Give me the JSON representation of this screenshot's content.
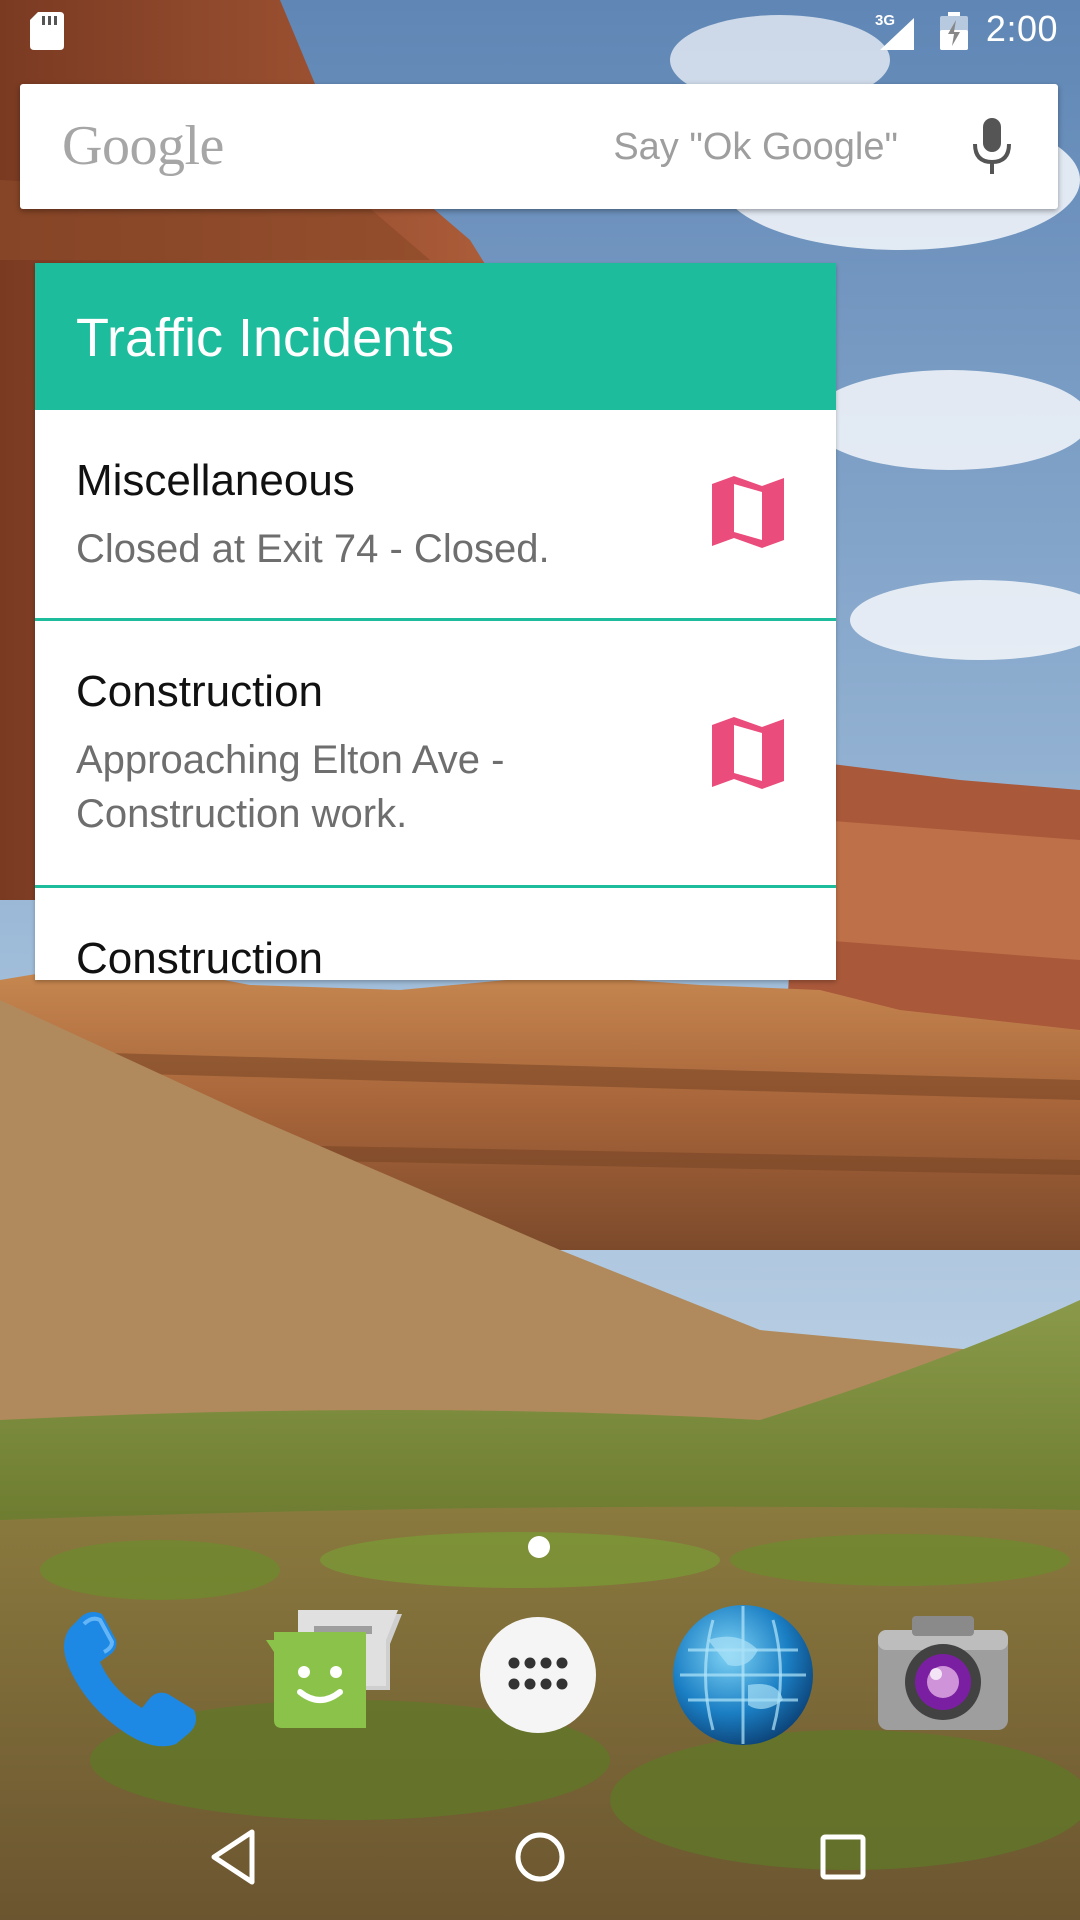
{
  "status_bar": {
    "network": "3G",
    "time": "2:00",
    "icons": [
      "sd-card-icon",
      "signal-icon",
      "battery-charging-icon"
    ]
  },
  "search_bar": {
    "logo": "Google",
    "hint": "Say \"Ok Google\"",
    "icon": "mic-icon"
  },
  "widget": {
    "title": "Traffic Incidents",
    "accent_color": "#1dbc9c",
    "map_icon_color": "#ea4c7c",
    "incidents": [
      {
        "type": "Miscellaneous",
        "description": "Closed at Exit 74 - Closed.",
        "icon": "map-icon"
      },
      {
        "type": "Construction",
        "description": "Approaching Elton Ave - Construction work.",
        "icon": "map-icon"
      },
      {
        "type": "Construction",
        "description": "",
        "icon": ""
      }
    ]
  },
  "dock": {
    "apps": [
      {
        "name": "phone-icon"
      },
      {
        "name": "messaging-icon"
      },
      {
        "name": "app-drawer-icon"
      },
      {
        "name": "browser-icon"
      },
      {
        "name": "camera-icon"
      }
    ]
  },
  "nav_bar": {
    "buttons": [
      "back-icon",
      "home-icon",
      "recents-icon"
    ]
  }
}
